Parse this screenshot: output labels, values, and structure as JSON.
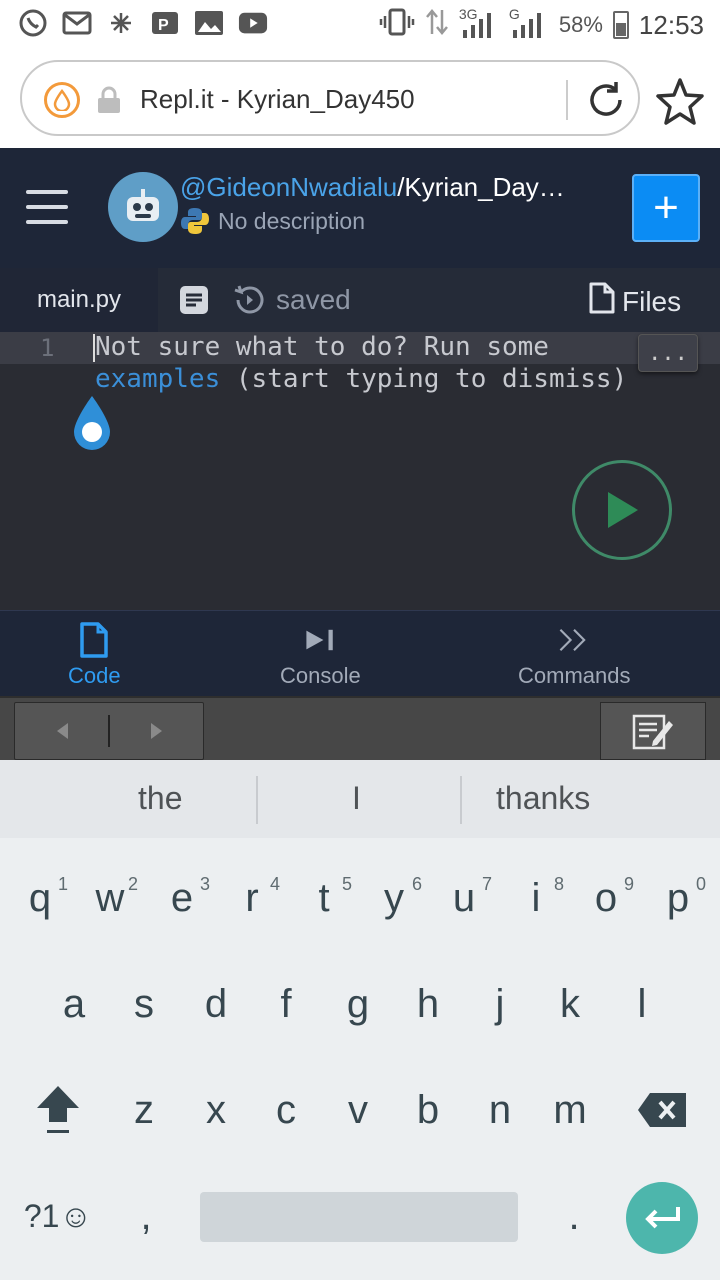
{
  "status_bar": {
    "network": "3G",
    "network2": "G",
    "battery": "58%",
    "time": "12:53"
  },
  "browser": {
    "url_title": "Repl.it - Kyrian_Day450"
  },
  "repl": {
    "owner": "@GideonNwadialu",
    "name": "/Kyrian_Day…",
    "description": "No description",
    "add_label": "+"
  },
  "tabs": {
    "file": "main.py",
    "saved": "saved",
    "files": "Files"
  },
  "editor": {
    "line_number": "1",
    "line1": "Not sure what to do? Run some",
    "line2_link": "examples",
    "line2_rest": " (start typing to dismiss)",
    "more": "..."
  },
  "bottom_nav": {
    "code": "Code",
    "console": "Console",
    "commands": "Commands"
  },
  "suggestions": [
    "the",
    "I",
    "thanks"
  ],
  "keyboard": {
    "row1": [
      "q",
      "w",
      "e",
      "r",
      "t",
      "y",
      "u",
      "i",
      "o",
      "p"
    ],
    "row1_hints": [
      "1",
      "2",
      "3",
      "4",
      "5",
      "6",
      "7",
      "8",
      "9",
      "0"
    ],
    "row2": [
      "a",
      "s",
      "d",
      "f",
      "g",
      "h",
      "j",
      "k",
      "l"
    ],
    "row3": [
      "z",
      "x",
      "c",
      "v",
      "b",
      "n",
      "m"
    ],
    "symbols": "?1☺",
    "comma": ",",
    "period": "."
  },
  "colors": {
    "accent": "#2f9bf0",
    "header_bg": "#1e2638",
    "editor_bg": "#2a2c33",
    "run_green": "#2e8b57",
    "enter_teal": "#4db6ac"
  }
}
